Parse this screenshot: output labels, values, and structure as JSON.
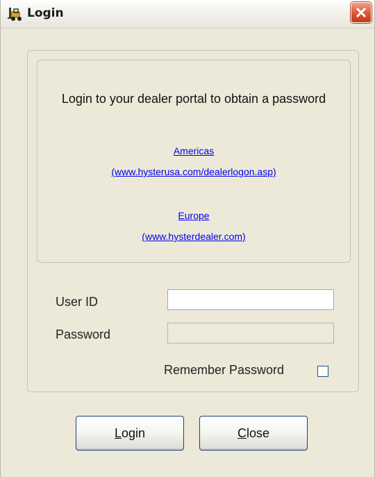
{
  "window": {
    "title": "Login"
  },
  "info": {
    "message": "Login to your dealer portal to obtain a password",
    "americas_label": "Americas",
    "americas_url": "(www.hysterusa.com/dealerlogon.asp)",
    "europe_label": "Europe",
    "europe_url": "(www.hysterdealer.com)"
  },
  "form": {
    "user_id_label": "User ID",
    "user_id_value": "",
    "password_label": "Password",
    "password_value": "",
    "remember_label": "Remember Password",
    "remember_checked": false
  },
  "buttons": {
    "login_first": "L",
    "login_rest": "ogin",
    "close_first": "C",
    "close_rest": "lose"
  },
  "colors": {
    "window_bg": "#ece9d8",
    "link": "#0000ee",
    "close_button": "#d9502e"
  },
  "icons": {
    "app": "forklift-icon",
    "close": "close-icon"
  }
}
